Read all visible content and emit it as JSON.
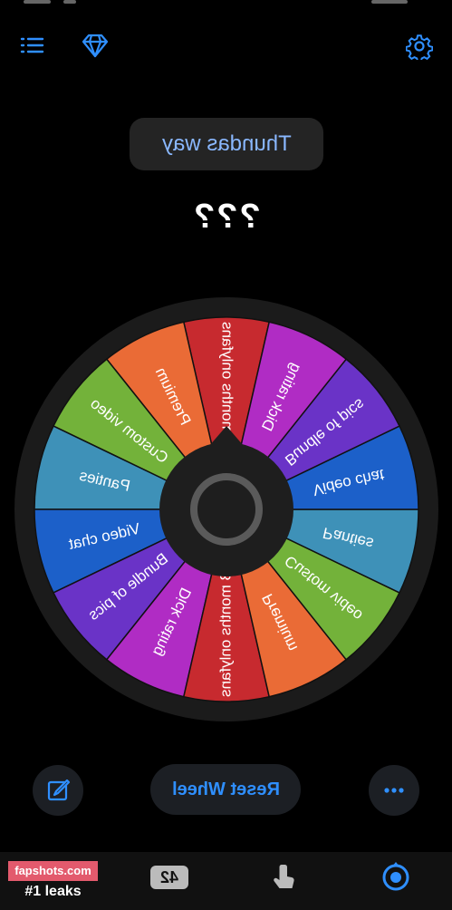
{
  "header": {
    "menu_icon": "list-menu-icon",
    "premium_icon": "diamond-icon",
    "settings_icon": "gear-icon"
  },
  "preset": {
    "name": "Thundas way"
  },
  "result": {
    "text": "???"
  },
  "wheel": {
    "segments": [
      {
        "label": "3 months onlyfans",
        "color": "#c72a2f"
      },
      {
        "label": "Premium",
        "color": "#ea6b36"
      },
      {
        "label": "Custom video",
        "color": "#73b23a"
      },
      {
        "label": "Panties",
        "color": "#3e91b8"
      },
      {
        "label": "Video chat",
        "color": "#1c60c9"
      },
      {
        "label": "Bundle of pics",
        "color": "#6a33c7"
      },
      {
        "label": "Dick rating",
        "color": "#b02cc4"
      },
      {
        "label": "3 months onlyfans",
        "color": "#c72a2f"
      },
      {
        "label": "Premium",
        "color": "#ea6b36"
      },
      {
        "label": "Custom video",
        "color": "#73b23a"
      },
      {
        "label": "Panties",
        "color": "#3e91b8"
      },
      {
        "label": "Video chat",
        "color": "#1c60c9"
      },
      {
        "label": "Bundle of pics",
        "color": "#6a33c7"
      },
      {
        "label": "Dick rating",
        "color": "#b02cc4"
      }
    ]
  },
  "controls": {
    "edit_icon": "edit-icon",
    "reset_label": "Reset Wheel",
    "more_icon": "more-dots-icon"
  },
  "watermark": {
    "line1": "fapshots.com",
    "line2": "#1 leaks"
  },
  "navbar": {
    "badge": "42",
    "pointer_icon": "hand-pointer-icon",
    "wheel_icon": "target-icon"
  },
  "colors": {
    "accent": "#2f8fff",
    "background": "#000000"
  }
}
